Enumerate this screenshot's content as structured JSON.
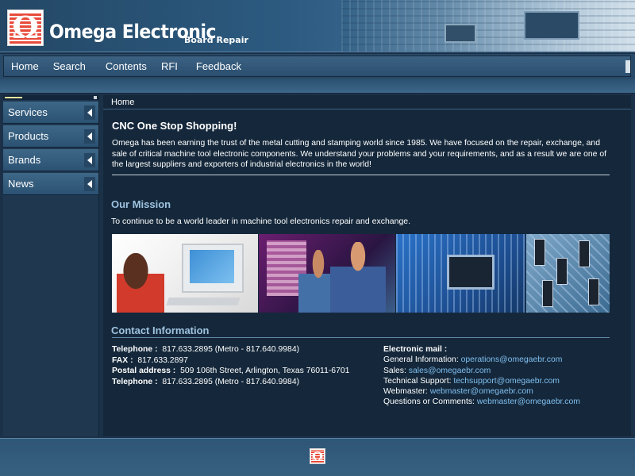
{
  "header": {
    "logo_icon": "omega-logo-icon",
    "logo_glyph": "Ω",
    "brand_name": "Omega Electronic",
    "brand_sub": "Board Repair"
  },
  "nav": {
    "items": [
      "Home",
      "Search",
      "Contents",
      "RFI",
      "Feedback"
    ]
  },
  "sidebar": {
    "items": [
      "Services",
      "Products",
      "Brands",
      "News"
    ]
  },
  "breadcrumb": "Home",
  "intro": {
    "title": "CNC One Stop Shopping!",
    "text": "Omega has been earning the trust of the metal cutting and stamping world since 1985.  We have focused on the repair, exchange, and sale of critical machine tool electronic components.  We understand your problems and your requirements, and as a result we are one of the largest suppliers and exporters of industrial electronics in the world!"
  },
  "mission": {
    "title": "Our Mission",
    "text": "To continue to be a world leader in machine tool electronics repair and exchange."
  },
  "contact": {
    "title": "Contact Information",
    "left": [
      {
        "label": "Telephone :",
        "value": "817.633.2895  (Metro - 817.640.9984)"
      },
      {
        "label": "FAX :",
        "value": "817.633.2897"
      },
      {
        "label": "Postal address :",
        "value": "509 106th Street, Arlington, Texas 76011-6701"
      },
      {
        "label": "Telephone :",
        "value": "817.633.2895  (Metro - 817.640.9984)"
      }
    ],
    "right_title": "Electronic mail :",
    "right": [
      {
        "label": "General Information:",
        "value": "operations@omegaebr.com"
      },
      {
        "label": "Sales:",
        "value": "sales@omegaebr.com"
      },
      {
        "label": "Technical Support:",
        "value": "techsupport@omegaebr.com"
      },
      {
        "label": "Webmaster:",
        "value": "webmaster@omegaebr.com"
      },
      {
        "label": "Questions or Comments:",
        "value": "webmaster@omegaebr.com"
      }
    ]
  },
  "colors": {
    "background": "#1b3148",
    "accent": "#9ec3e0",
    "link": "#7fbff0",
    "logo_red": "#e84a3a"
  }
}
